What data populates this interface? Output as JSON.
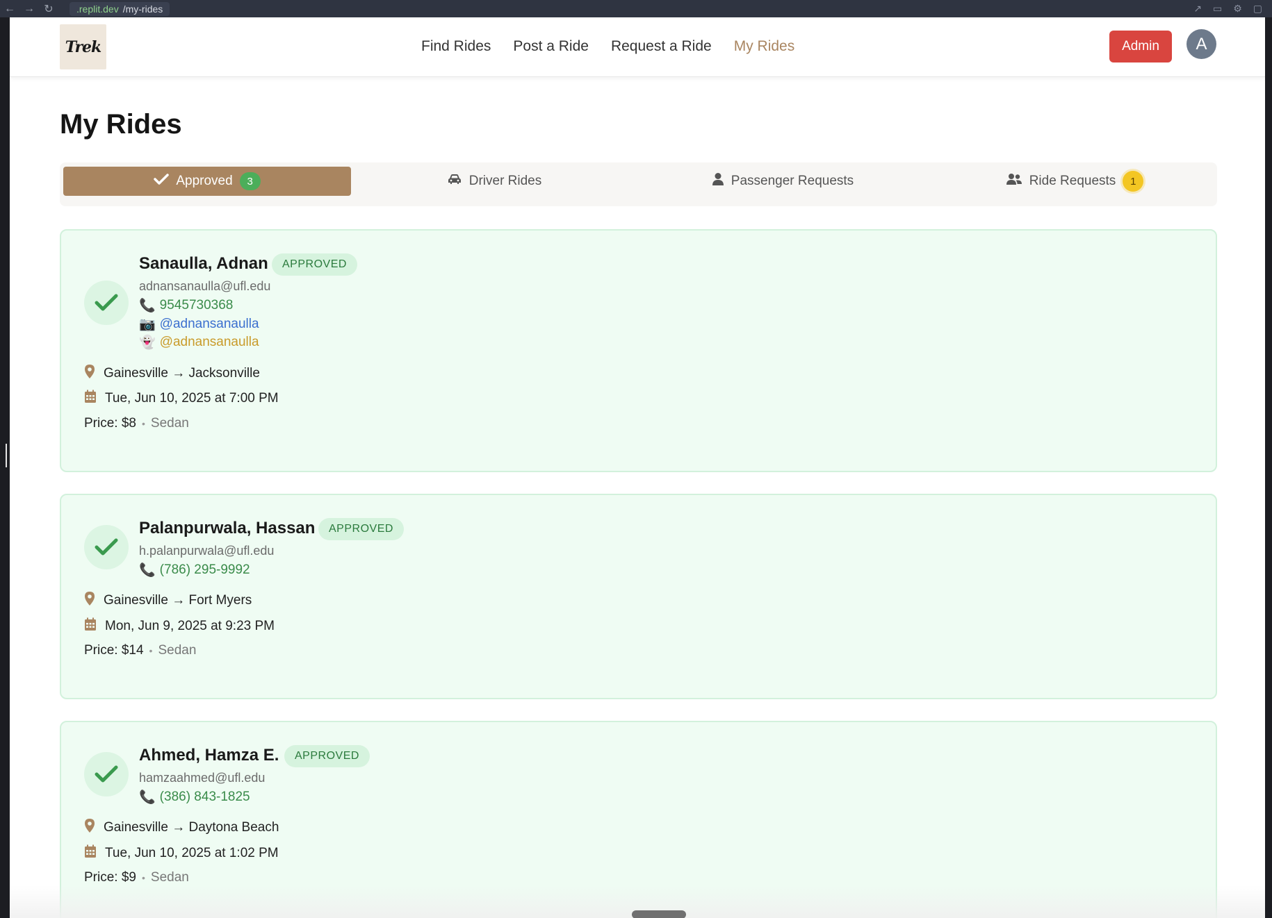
{
  "browser": {
    "url_host": ".replit.dev",
    "url_path": "/my-rides"
  },
  "nav": {
    "logo": "Trek",
    "links": [
      "Find Rides",
      "Post a Ride",
      "Request a Ride",
      "My Rides"
    ],
    "active_link": "My Rides",
    "admin_label": "Admin",
    "avatar_initial": "A"
  },
  "page": {
    "title": "My Rides"
  },
  "tabs": [
    {
      "label": "Approved",
      "icon": "check-icon",
      "badge": "3",
      "active": true
    },
    {
      "label": "Driver Rides",
      "icon": "car-icon",
      "badge": "",
      "active": false
    },
    {
      "label": "Passenger Requests",
      "icon": "user-icon",
      "badge": "",
      "active": false
    },
    {
      "label": "Ride Requests",
      "icon": "users-icon",
      "badge": "1",
      "active": false
    }
  ],
  "rides": [
    {
      "name": "Sanaulla, Adnan",
      "status": "APPROVED",
      "email": "adnansanaulla@ufl.edu",
      "phone": "9545730368",
      "instagram": "@adnansanaulla",
      "snapchat": "@adnansanaulla",
      "route": "Gainesville → Jacksonville",
      "datetime": "Tue, Jun 10, 2025 at 7:00 PM",
      "price": "Price: $8",
      "vehicle": "Sedan"
    },
    {
      "name": "Palanpurwala, Hassan",
      "status": "APPROVED",
      "email": "h.palanpurwala@ufl.edu",
      "phone": "(786) 295-9992",
      "route": "Gainesville → Fort Myers",
      "datetime": "Mon, Jun 9, 2025 at 9:23 PM",
      "price": "Price: $14",
      "vehicle": "Sedan"
    },
    {
      "name": "Ahmed, Hamza E.",
      "status": "APPROVED",
      "email": "hamzaahmed@ufl.edu",
      "phone": "(386) 843-1825",
      "route": "Gainesville → Daytona Beach",
      "datetime": "Tue, Jun 10, 2025 at 1:02 PM",
      "price": "Price: $9",
      "vehicle": "Sedan"
    }
  ],
  "colors": {
    "accent": "#a98560",
    "admin": "#d9453f",
    "approved_green": "#4cae5a",
    "card_bg": "#effcf3",
    "badge_yellow": "#f3c623"
  }
}
